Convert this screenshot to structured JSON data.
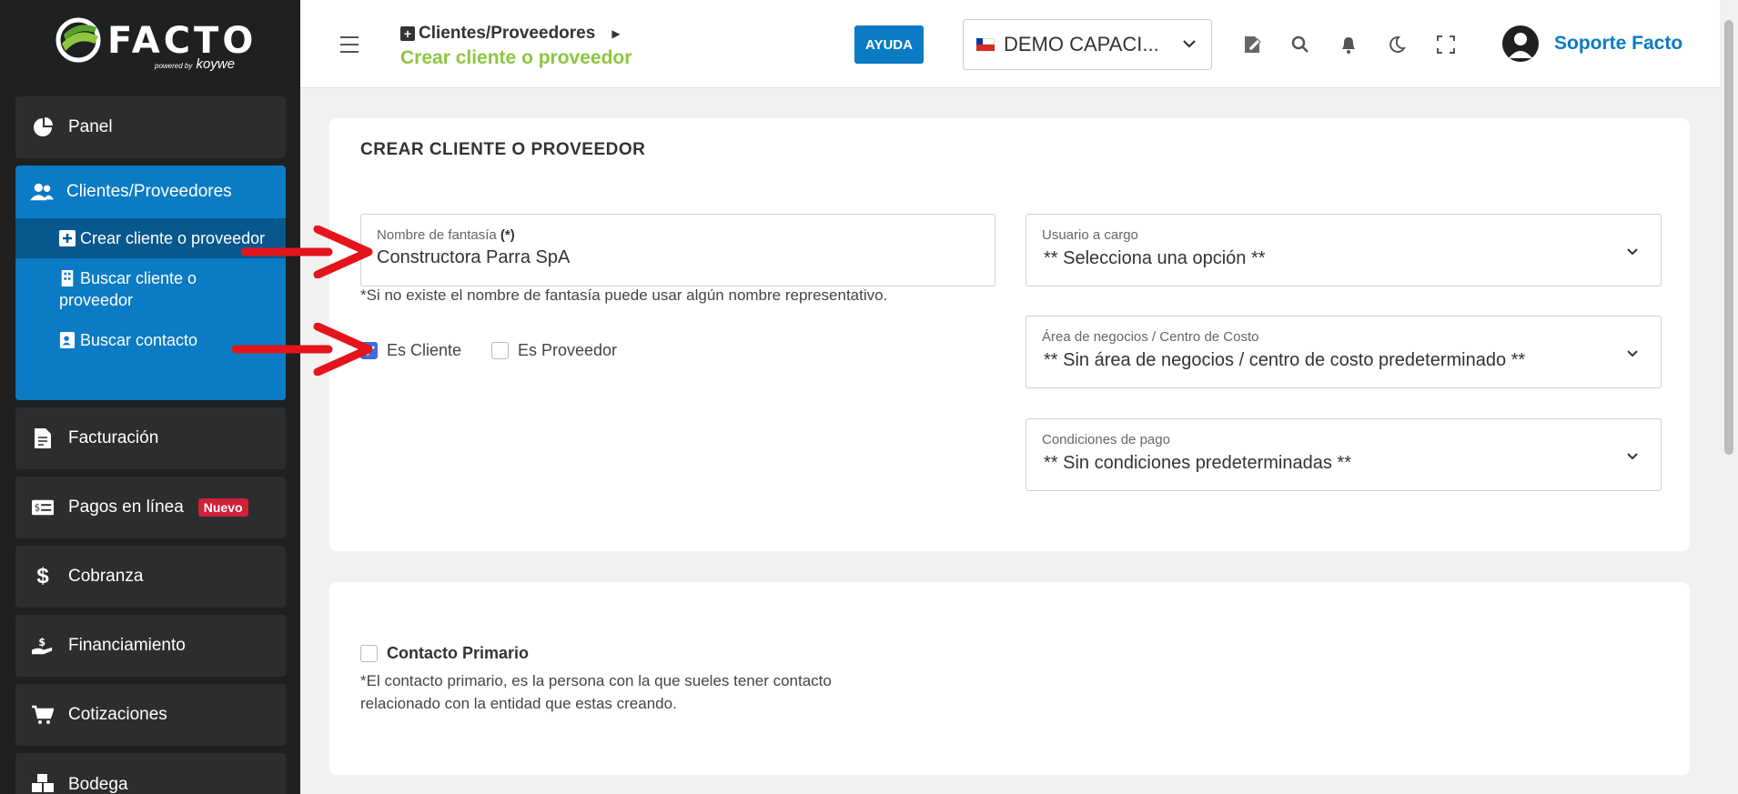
{
  "app": {
    "logo_text": "FACTO",
    "logo_sub_small": "powered by",
    "logo_sub": "koywe"
  },
  "sidebar": {
    "items": [
      {
        "label": "Panel",
        "icon": "pie-chart-icon"
      },
      {
        "label": "Clientes/Proveedores",
        "icon": "users-icon"
      },
      {
        "label": "Facturación",
        "icon": "document-icon"
      },
      {
        "label": "Pagos en línea",
        "icon": "money-bill-icon",
        "badge": "Nuevo"
      },
      {
        "label": "Cobranza",
        "icon": "dollar-icon"
      },
      {
        "label": "Financiamiento",
        "icon": "hand-coin-icon"
      },
      {
        "label": "Cotizaciones",
        "icon": "cart-icon"
      },
      {
        "label": "Bodega",
        "icon": "boxes-icon"
      }
    ],
    "subitems": [
      {
        "label": "Crear cliente o proveedor",
        "icon": "plus-square-icon",
        "selected": true
      },
      {
        "label": "Buscar cliente o proveedor",
        "icon": "building-icon"
      },
      {
        "label": "Buscar contacto",
        "icon": "contact-card-icon"
      }
    ]
  },
  "header": {
    "breadcrumb_parent": "Clientes/Proveedores",
    "page_title": "Crear cliente o proveedor",
    "help_label": "AYUDA",
    "company_name": "DEMO CAPACI...",
    "user_name": "Soporte Facto"
  },
  "form": {
    "title": "CREAR CLIENTE O PROVEEDOR",
    "fantasy_name_label": "Nombre de fantasía",
    "fantasy_name_required": "(*)",
    "fantasy_name_value": "Constructora Parra SpA",
    "fantasy_name_hint": "*Si no existe el nombre de fantasía puede usar algún nombre representativo.",
    "is_client_label": "Es Cliente",
    "is_client_checked": true,
    "is_provider_label": "Es Proveedor",
    "is_provider_checked": false,
    "user_in_charge_label": "Usuario a cargo",
    "user_in_charge_value": "** Selecciona una opción **",
    "business_area_label": "Área de negocios / Centro de Costo",
    "business_area_value": "** Sin área de negocios / centro de costo predeterminado **",
    "payment_terms_label": "Condiciones de pago",
    "payment_terms_value": "** Sin condiciones predeterminadas **"
  },
  "contact": {
    "primary_label": "Contacto Primario",
    "primary_checked": false,
    "primary_hint_line1": "*El contacto primario, es la persona con la que sueles tener contacto",
    "primary_hint_line2": "relacionado con la entidad que estas creando."
  },
  "colors": {
    "sidebar_bg": "#1e2021",
    "accent_blue": "#0a7bc4",
    "accent_green": "#8dc63f",
    "badge_red": "#d0213a",
    "annotation_arrow": "#e3141b"
  }
}
